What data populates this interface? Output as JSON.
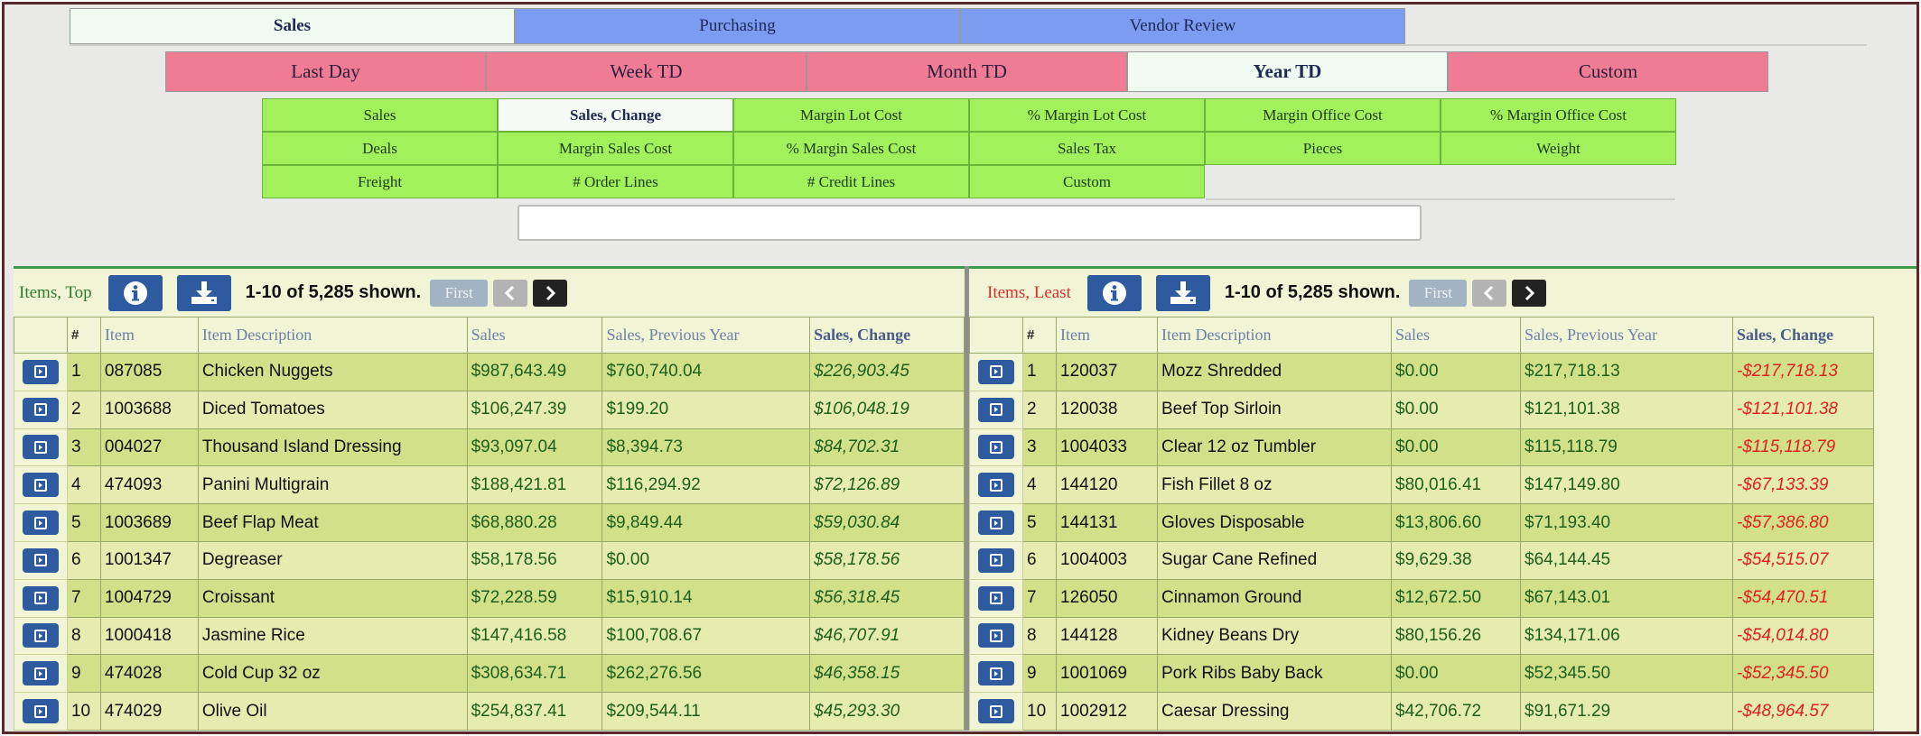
{
  "nav": {
    "main_tabs": [
      {
        "label": "Sales",
        "active": true
      },
      {
        "label": "Purchasing",
        "active": false
      },
      {
        "label": "Vendor Review",
        "active": false
      }
    ],
    "period_tabs": [
      {
        "label": "Last Day",
        "active": false
      },
      {
        "label": "Week TD",
        "active": false
      },
      {
        "label": "Month TD",
        "active": false
      },
      {
        "label": "Year TD",
        "active": true
      },
      {
        "label": "Custom",
        "active": false
      }
    ],
    "metric_rows": [
      [
        {
          "label": "Sales",
          "active": false
        },
        {
          "label": "Sales, Change",
          "active": true
        },
        {
          "label": "Margin Lot Cost",
          "active": false
        },
        {
          "label": "% Margin Lot Cost",
          "active": false
        },
        {
          "label": "Margin Office Cost",
          "active": false
        },
        {
          "label": "% Margin Office Cost",
          "active": false
        }
      ],
      [
        {
          "label": "Deals",
          "active": false
        },
        {
          "label": "Margin Sales Cost",
          "active": false
        },
        {
          "label": "% Margin Sales Cost",
          "active": false
        },
        {
          "label": "Sales Tax",
          "active": false
        },
        {
          "label": "Pieces",
          "active": false
        },
        {
          "label": "Weight",
          "active": false
        }
      ],
      [
        {
          "label": "Freight",
          "active": false
        },
        {
          "label": "# Order Lines",
          "active": false
        },
        {
          "label": "# Credit Lines",
          "active": false
        },
        {
          "label": "Custom",
          "active": false
        }
      ]
    ]
  },
  "search": {
    "value": "",
    "placeholder": ""
  },
  "colors": {
    "main_tab": "#7c9cf2",
    "period_tab": "#f07b94",
    "metric_tab": "#a3f05d",
    "positive": "#1c5e1c",
    "negative": "#e02020"
  },
  "columns": [
    "#",
    "Item",
    "Item Description",
    "Sales",
    "Sales, Previous Year",
    "Sales, Change"
  ],
  "panels": {
    "top": {
      "title": "Items, Top",
      "shown": "1-10 of 5,285 shown.",
      "first_label": "First",
      "rows": [
        [
          "1",
          "087085",
          "Chicken Nuggets",
          "$987,643.49",
          "$760,740.04",
          "$226,903.45"
        ],
        [
          "2",
          "1003688",
          "Diced Tomatoes",
          "$106,247.39",
          "$199.20",
          "$106,048.19"
        ],
        [
          "3",
          "004027",
          "Thousand Island Dressing",
          "$93,097.04",
          "$8,394.73",
          "$84,702.31"
        ],
        [
          "4",
          "474093",
          "Panini Multigrain",
          "$188,421.81",
          "$116,294.92",
          "$72,126.89"
        ],
        [
          "5",
          "1003689",
          "Beef Flap Meat",
          "$68,880.28",
          "$9,849.44",
          "$59,030.84"
        ],
        [
          "6",
          "1001347",
          "Degreaser",
          "$58,178.56",
          "$0.00",
          "$58,178.56"
        ],
        [
          "7",
          "1004729",
          "Croissant",
          "$72,228.59",
          "$15,910.14",
          "$56,318.45"
        ],
        [
          "8",
          "1000418",
          "Jasmine Rice",
          "$147,416.58",
          "$100,708.67",
          "$46,707.91"
        ],
        [
          "9",
          "474028",
          "Cold Cup 32 oz",
          "$308,634.71",
          "$262,276.56",
          "$46,358.15"
        ],
        [
          "10",
          "474029",
          "Olive Oil",
          "$254,837.41",
          "$209,544.11",
          "$45,293.30"
        ]
      ]
    },
    "least": {
      "title": "Items, Least",
      "shown": "1-10 of 5,285 shown.",
      "first_label": "First",
      "rows": [
        [
          "1",
          "120037",
          "Mozz Shredded",
          "$0.00",
          "$217,718.13",
          "-$217,718.13"
        ],
        [
          "2",
          "120038",
          "Beef Top Sirloin",
          "$0.00",
          "$121,101.38",
          "-$121,101.38"
        ],
        [
          "3",
          "1004033",
          "Clear 12 oz Tumbler",
          "$0.00",
          "$115,118.79",
          "-$115,118.79"
        ],
        [
          "4",
          "144120",
          "Fish Fillet 8 oz",
          "$80,016.41",
          "$147,149.80",
          "-$67,133.39"
        ],
        [
          "5",
          "144131",
          "Gloves Disposable",
          "$13,806.60",
          "$71,193.40",
          "-$57,386.80"
        ],
        [
          "6",
          "1004003",
          "Sugar Cane Refined",
          "$9,629.38",
          "$64,144.45",
          "-$54,515.07"
        ],
        [
          "7",
          "126050",
          "Cinnamon Ground",
          "$12,672.50",
          "$67,143.01",
          "-$54,470.51"
        ],
        [
          "8",
          "144128",
          "Kidney Beans Dry",
          "$80,156.26",
          "$134,171.06",
          "-$54,014.80"
        ],
        [
          "9",
          "1001069",
          "Pork Ribs Baby Back",
          "$0.00",
          "$52,345.50",
          "-$52,345.50"
        ],
        [
          "10",
          "1002912",
          "Caesar Dressing",
          "$42,706.72",
          "$91,671.29",
          "-$48,964.57"
        ]
      ]
    }
  }
}
